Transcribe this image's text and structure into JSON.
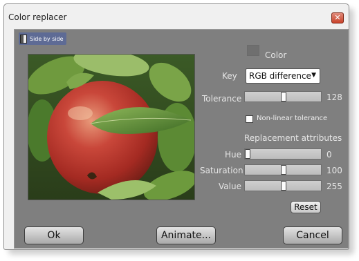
{
  "window": {
    "title": "Color replacer",
    "close_glyph": "✕"
  },
  "toolbar": {
    "side_by_side_label": "Side by side"
  },
  "controls": {
    "color_label": "Color",
    "key_label": "Key",
    "key_value": "RGB difference",
    "tolerance_label": "Tolerance",
    "tolerance_value": "128",
    "nonlinear_label": "Non-linear tolerance",
    "nonlinear_checked": false
  },
  "replacement": {
    "heading": "Replacement attributes",
    "hue_label": "Hue",
    "hue_value": "0",
    "saturation_label": "Saturation",
    "saturation_value": "100",
    "value_label": "Value",
    "value_value": "255",
    "reset_label": "Reset"
  },
  "buttons": {
    "ok": "Ok",
    "animate": "Animate...",
    "cancel": "Cancel"
  },
  "colors": {
    "panel_bg": "#7f7f7f",
    "swatch": "#6f6f6f",
    "side_by_side_bg": "#5e6b95"
  },
  "icons": {
    "side_by_side": "split-view-icon",
    "dropdown": "chevron-down-icon",
    "close": "close-icon"
  }
}
